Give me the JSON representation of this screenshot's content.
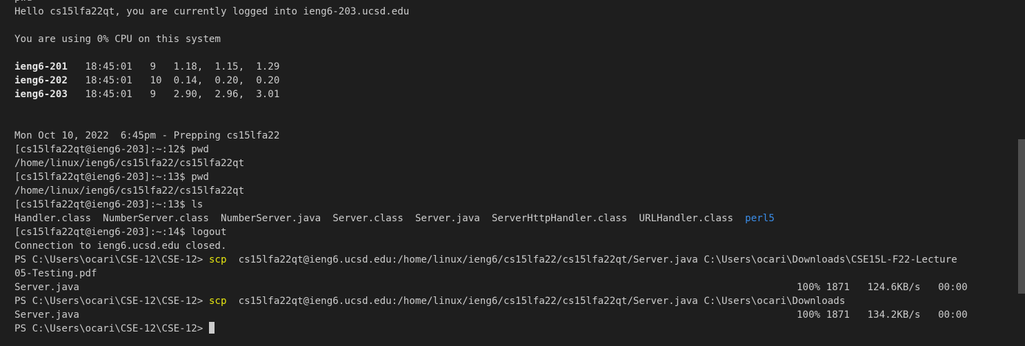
{
  "lines": {
    "l0": "pwd",
    "l1": "Hello cs15lfa22qt, you are currently logged into ieng6-203.ucsd.edu",
    "l3": "You are using 0% CPU on this system"
  },
  "hosts": [
    {
      "name": "ieng6-201",
      "stats": "   18:45:01   9   1.18,  1.15,  1.29"
    },
    {
      "name": "ieng6-202",
      "stats": "   18:45:01   10  0.14,  0.20,  0.20"
    },
    {
      "name": "ieng6-203",
      "stats": "   18:45:01   9   2.90,  2.96,  3.01"
    }
  ],
  "session": {
    "banner": "Mon Oct 10, 2022  6:45pm - Prepping cs15lfa22",
    "p12_pwd": "[cs15lfa22qt@ieng6-203]:~:12$ pwd",
    "pwd_out1": "/home/linux/ieng6/cs15lfa22/cs15lfa22qt",
    "p13_pwd": "[cs15lfa22qt@ieng6-203]:~:13$ pwd",
    "pwd_out2": "/home/linux/ieng6/cs15lfa22/cs15lfa22qt",
    "p13_ls": "[cs15lfa22qt@ieng6-203]:~:13$ ls",
    "ls_files": "Handler.class  NumberServer.class  NumberServer.java  Server.class  Server.java  ServerHttpHandler.class  URLHandler.class  ",
    "ls_dir": "perl5",
    "p14_logout": "[cs15lfa22qt@ieng6-203]:~:14$ logout",
    "closed": "Connection to ieng6.ucsd.edu closed."
  },
  "powershell": {
    "prompt": "PS C:\\Users\\ocari\\CSE-12\\CSE-12> ",
    "cmd": "scp",
    "scp1_args": "  cs15lfa22qt@ieng6.ucsd.edu:/home/linux/ieng6/cs15lfa22/cs15lfa22qt/Server.java C:\\Users\\ocari\\Downloads\\CSE15L-F22-Lecture",
    "scp1_wrap": "05-Testing.pdf",
    "scp2_args": "  cs15lfa22qt@ieng6.ucsd.edu:/home/linux/ieng6/cs15lfa22/cs15lfa22qt/Server.java C:\\Users\\ocari\\Downloads",
    "transfers": [
      {
        "file": "Server.java",
        "progress": "100% 1871   124.6KB/s   00:00"
      },
      {
        "file": "Server.java",
        "progress": "100% 1871   134.2KB/s   00:00"
      }
    ]
  },
  "colors": {
    "background": "#1e1e1e",
    "text": "#cccccc",
    "command": "#e5e510",
    "directory": "#3b8eea"
  }
}
